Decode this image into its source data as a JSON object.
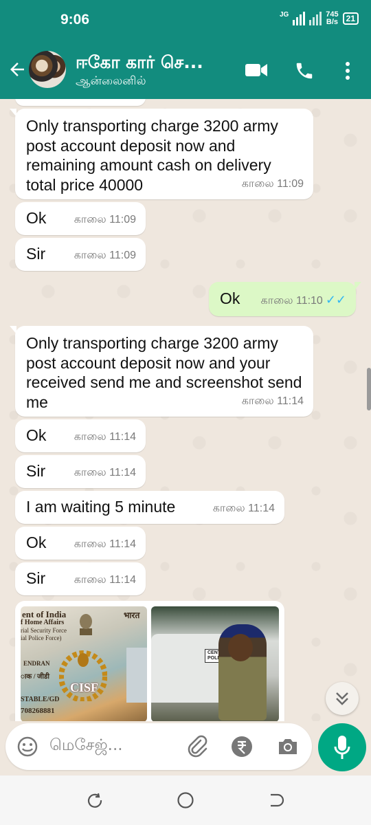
{
  "status_bar": {
    "time": "9:06",
    "network": "JG",
    "speed_value": "745",
    "speed_unit": "B/s",
    "battery": "21"
  },
  "header": {
    "contact_name": "ஈகோ கார் செ...",
    "contact_status": "ஆன்லைனில்"
  },
  "messages": [
    {
      "direction": "in",
      "text": "Only transporting charge 3200 army post account deposit now and remaining amount cash on delivery total price 40000",
      "time": "காலை 11:09"
    },
    {
      "direction": "in",
      "text": "Ok",
      "time": "காலை 11:09"
    },
    {
      "direction": "in",
      "text": "Sir",
      "time": "காலை 11:09"
    },
    {
      "direction": "out",
      "text": "Ok",
      "time": "காலை 11:10",
      "ticks": "✓✓"
    },
    {
      "direction": "in",
      "text": "Only transporting charge 3200 army post account deposit now and your received send me and screenshot send me",
      "time": "காலை 11:14"
    },
    {
      "direction": "in",
      "text": "Ok",
      "time": "காலை 11:14"
    },
    {
      "direction": "in",
      "text": "Sir",
      "time": "காலை 11:14"
    },
    {
      "direction": "in",
      "text": "I am waiting 5 minute",
      "time": "காலை 11:14"
    },
    {
      "direction": "in",
      "text": "Ok",
      "time": "காலை 11:14"
    },
    {
      "direction": "in",
      "text": "Sir",
      "time": "காலை 11:14"
    }
  ],
  "photos": {
    "id_card_lines": [
      "ent of India",
      "f Home Affairs",
      "rial Security Force",
      "ial Police Force)",
      "ЕNDRAN",
      "ाक / जीडी",
      "STABLE/GD",
      "708268881"
    ],
    "id_card_hindi": "भारत",
    "id_card_emblem_text": "CISF",
    "vehicle_board": "CENTRAL\nPOLICE"
  },
  "composer": {
    "placeholder": "மெசேஜ்..."
  },
  "colors": {
    "header": "#128c7e",
    "chat_background": "#efe7de",
    "incoming_bubble": "#ffffff",
    "outgoing_bubble": "#dcf8c6",
    "read_ticks": "#34b7f1",
    "mic_button": "#00a884"
  },
  "icons": [
    "back-arrow-icon",
    "video-call-icon",
    "phone-icon",
    "more-vert-icon",
    "emoji-icon",
    "attach-icon",
    "rupee-icon",
    "camera-icon",
    "mic-icon",
    "scroll-down-icon",
    "recents-icon",
    "home-icon",
    "back-nav-icon"
  ]
}
